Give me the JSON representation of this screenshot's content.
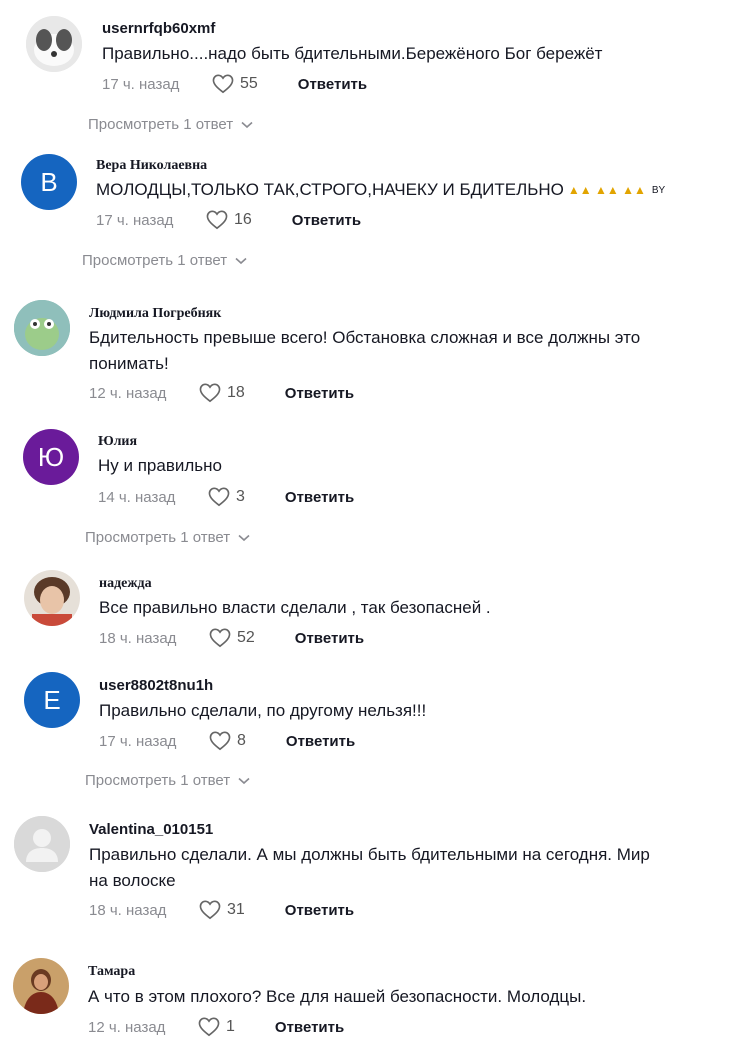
{
  "reply_label": "Ответить",
  "comments": [
    {
      "username": "usernrfqb60xmf",
      "text": "Правильно....надо быть бдительными.Бережёного Бог бережёт",
      "time": "17 ч. назад",
      "likes": "55",
      "more": "Просмотреть 1 ответ"
    },
    {
      "username": "Вера Николаевна",
      "avatar_letter": "B",
      "text": "МОЛОДЦЫ,ТОЛЬКО ТАК,СТРОГО,НАЧЕКУ И БДИТЕЛЬНО",
      "text_suffix": "BY",
      "time": "17 ч. назад",
      "likes": "16",
      "more": "Просмотреть 1 ответ"
    },
    {
      "username": "Людмила Погребняк",
      "text_line1": "Бдительность превыше всего! Обстановка сложная и все должны это",
      "text_line2": "понимать!",
      "time": "12 ч. назад",
      "likes": "18"
    },
    {
      "username": "Юлия",
      "avatar_letter": "Ю",
      "text": "Ну и правильно",
      "time": "14 ч. назад",
      "likes": "3",
      "more": "Просмотреть 1 ответ"
    },
    {
      "username": "надежда",
      "text": "Все правильно власти сделали , так безопасней .",
      "time": "18 ч. назад",
      "likes": "52"
    },
    {
      "username": "user8802t8nu1h",
      "avatar_letter": "E",
      "text": "Правильно сделали, по другому нельзя!!!",
      "time": "17 ч. назад",
      "likes": "8",
      "more": "Просмотреть 1 ответ"
    },
    {
      "username": "Valentina_010151",
      "text_line1": "Правильно сделали. А мы должны быть бдительными на сегодня. Мир",
      "text_line2": "на волоске",
      "time": "18 ч. назад",
      "likes": "31"
    },
    {
      "username": "Тамара",
      "text": "А что в этом плохого? Все для нашей безопасности. Молодцы.",
      "time": "12 ч. назад",
      "likes": "1"
    }
  ],
  "colors": {
    "letter_avatar_blue": "#1565c0",
    "letter_avatar_purple": "#6a1b9a",
    "praying_hands": "#e2a400"
  },
  "icons": {
    "like": "heart-outline-icon",
    "expand": "chevron-down-icon",
    "reaction": "praying-hands-icon"
  }
}
